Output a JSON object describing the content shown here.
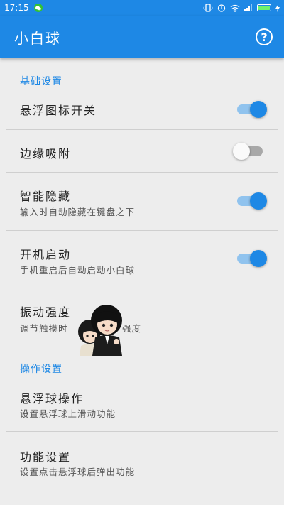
{
  "status_bar": {
    "time": "17:15"
  },
  "app_bar": {
    "title": "小白球",
    "help_icon": "help-circle-icon"
  },
  "sections": {
    "basic": "基础设置",
    "operation": "操作设置"
  },
  "settings": {
    "float_switch": {
      "title": "悬浮图标开关",
      "enabled": true
    },
    "edge_snap": {
      "title": "边缘吸附",
      "enabled": false
    },
    "smart_hide": {
      "title": "智能隐藏",
      "subtitle": "输入时自动隐藏在键盘之下",
      "enabled": true
    },
    "boot_start": {
      "title": "开机启动",
      "subtitle": "手机重启后自动启动小白球",
      "enabled": true
    },
    "vibration": {
      "title": "振动强度",
      "subtitle_left": "调节触摸时",
      "subtitle_right": "强度"
    },
    "ball_operation": {
      "title": "悬浮球操作",
      "subtitle": "设置悬浮球上滑动功能"
    },
    "function_settings": {
      "title": "功能设置",
      "subtitle": "设置点击悬浮球后弹出功能"
    }
  },
  "colors": {
    "accent": "#1e88e5",
    "background": "#ededed"
  }
}
